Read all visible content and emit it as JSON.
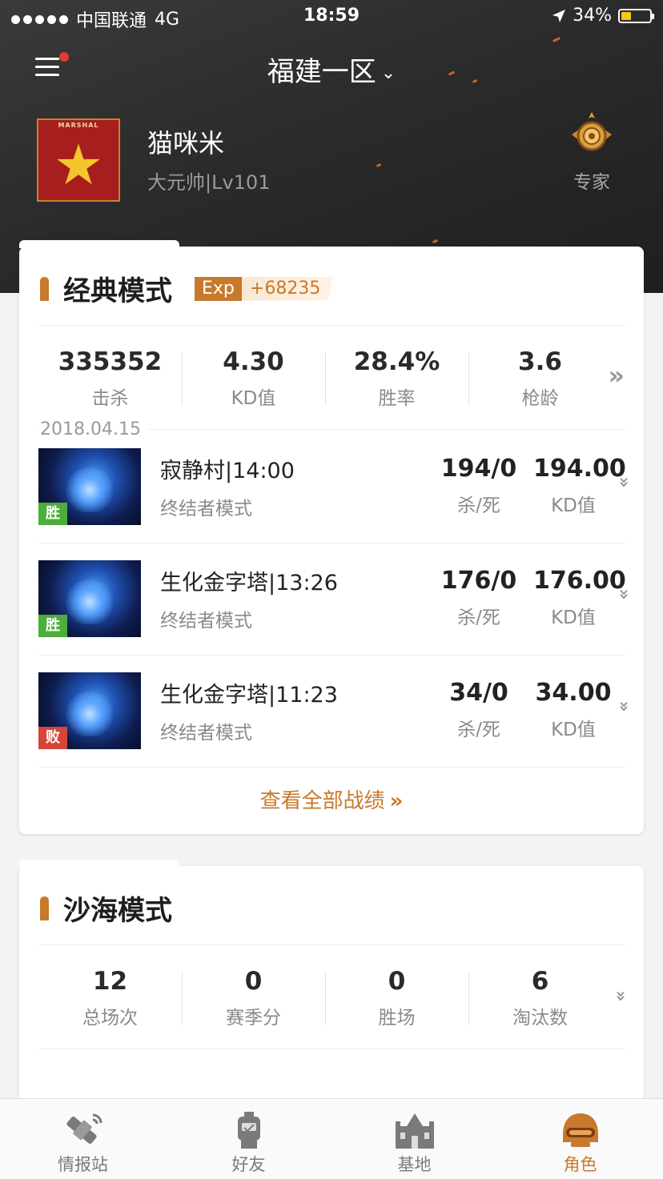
{
  "status_bar": {
    "carrier": "中国联通",
    "network": "4G",
    "time": "18:59",
    "battery": "34%",
    "battery_level": 0.34
  },
  "header": {
    "server": "福建一区",
    "badge_text": "MARSHAL",
    "player_name": "猫咪米",
    "player_level": "大元帅|Lv101",
    "expert_label": "专家"
  },
  "classic": {
    "title": "经典模式",
    "exp_key": "Exp",
    "exp_value": "+68235",
    "stats": [
      {
        "value": "335352",
        "label": "击杀"
      },
      {
        "value": "4.30",
        "label": "KD值"
      },
      {
        "value": "28.4%",
        "label": "胜率"
      },
      {
        "value": "3.6",
        "label": "枪龄"
      }
    ],
    "date": "2018.04.15",
    "matches": [
      {
        "name": "寂静村|14:00",
        "mode": "终结者模式",
        "result": "胜",
        "kills": "194/0",
        "kills_label": "杀/死",
        "kd": "194.00",
        "kd_label": "KD值"
      },
      {
        "name": "生化金字塔|13:26",
        "mode": "终结者模式",
        "result": "胜",
        "kills": "176/0",
        "kills_label": "杀/死",
        "kd": "176.00",
        "kd_label": "KD值"
      },
      {
        "name": "生化金字塔|11:23",
        "mode": "终结者模式",
        "result": "败",
        "kills": "34/0",
        "kills_label": "杀/死",
        "kd": "34.00",
        "kd_label": "KD值"
      }
    ],
    "view_all": "查看全部战绩",
    "view_all_arrow": "»"
  },
  "desert": {
    "title": "沙海模式",
    "stats": [
      {
        "value": "12",
        "label": "总场次"
      },
      {
        "value": "0",
        "label": "赛季分"
      },
      {
        "value": "0",
        "label": "胜场"
      },
      {
        "value": "6",
        "label": "淘汰数"
      }
    ]
  },
  "tabbar": [
    {
      "label": "情报站",
      "icon": "satellite-icon"
    },
    {
      "label": "好友",
      "icon": "robot-icon"
    },
    {
      "label": "基地",
      "icon": "castle-icon"
    },
    {
      "label": "角色",
      "icon": "helmet-icon",
      "active": true
    }
  ],
  "colors": {
    "accent": "#c8792c",
    "win": "#4cae3a",
    "lose": "#d6453a",
    "header_bg": "#2b2b2b"
  }
}
